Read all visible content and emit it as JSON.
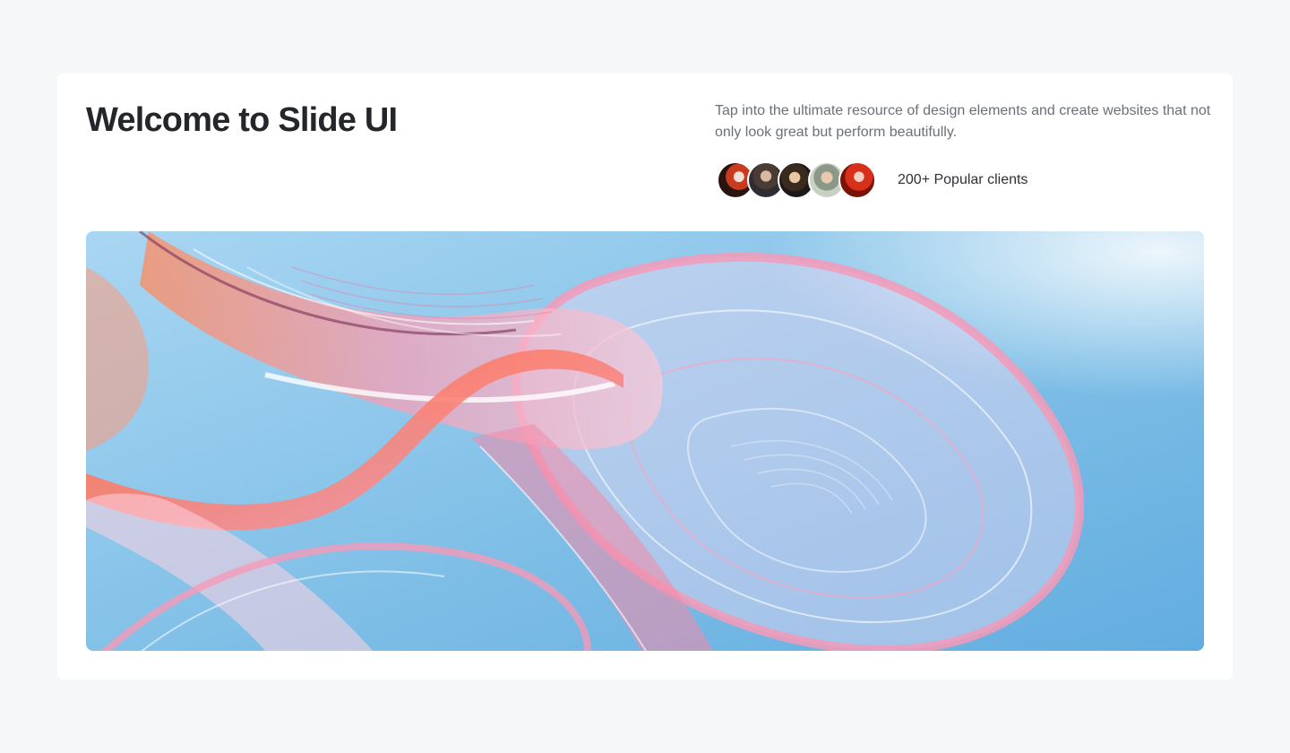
{
  "hero_section": {
    "title": "Welcome to Slide UI",
    "description": "Tap into the ultimate resource of design elements and create websites that not only look great but perform beautifully.",
    "clients": {
      "label": "200+ Popular clients",
      "avatars": [
        "client-avatar-1",
        "client-avatar-2",
        "client-avatar-3",
        "client-avatar-4",
        "client-avatar-5"
      ]
    }
  }
}
